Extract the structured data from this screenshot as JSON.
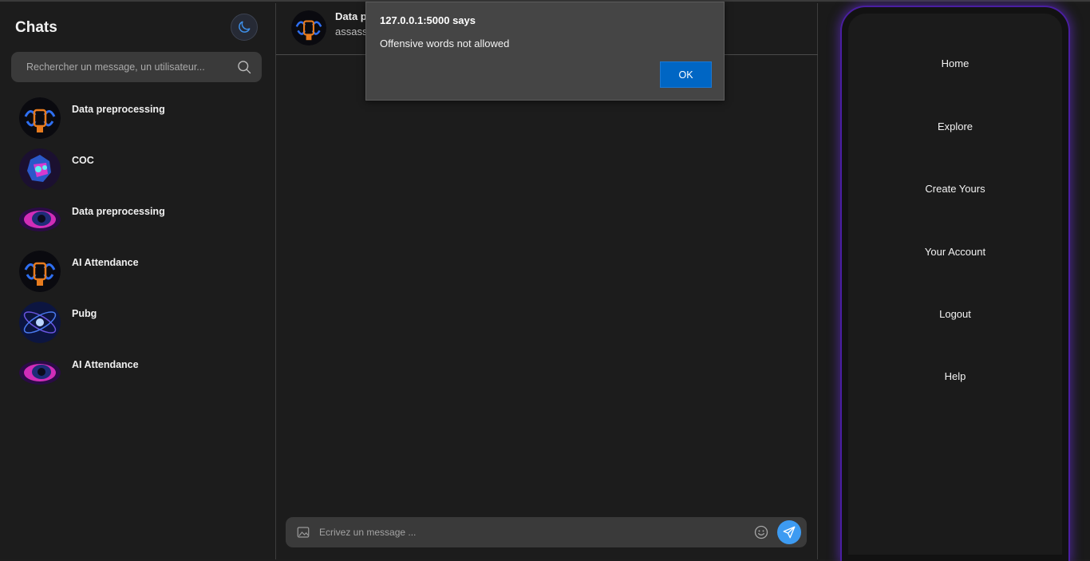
{
  "sidebar": {
    "title": "Chats",
    "search_placeholder": "Rechercher un message, un utilisateur...",
    "chats": [
      {
        "name": "Data preprocessing",
        "avatar": "robot-fist-avatar"
      },
      {
        "name": "COC",
        "avatar": "neon-creature-avatar"
      },
      {
        "name": "Data preprocessing",
        "avatar": "neon-eye-avatar"
      },
      {
        "name": "AI Attendance",
        "avatar": "robot-fist-avatar"
      },
      {
        "name": "Pubg",
        "avatar": "blue-star-avatar"
      },
      {
        "name": "AI Attendance",
        "avatar": "neon-eye-avatar"
      }
    ]
  },
  "chat_header": {
    "title": "Data p",
    "subtitle": "assass"
  },
  "composer": {
    "placeholder": "Ecrivez un message ..."
  },
  "nav": {
    "items": [
      "Home",
      "Explore",
      "Create Yours",
      "Your Account",
      "Logout",
      "Help"
    ]
  },
  "alert": {
    "title": "127.0.0.1:5000 says",
    "message": "Offensive words not allowed",
    "ok_label": "OK"
  },
  "colors": {
    "background": "#1c1c1c",
    "accent_blue": "#3d9bf2",
    "dialog_button": "#0066c4",
    "phone_glow": "#6e32e6"
  }
}
